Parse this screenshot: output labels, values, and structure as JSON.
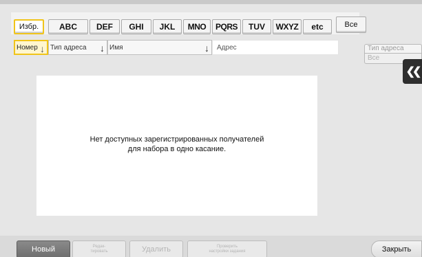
{
  "tabs": [
    {
      "id": "favorites",
      "label": "Избр.",
      "selected": true
    },
    {
      "id": "abc",
      "label": "ABC",
      "selected": false
    },
    {
      "id": "def",
      "label": "DEF",
      "selected": false
    },
    {
      "id": "ghi",
      "label": "GHI",
      "selected": false
    },
    {
      "id": "jkl",
      "label": "JKL",
      "selected": false
    },
    {
      "id": "mno",
      "label": "MNO",
      "selected": false
    },
    {
      "id": "pqrs",
      "label": "PQRS",
      "selected": false
    },
    {
      "id": "tuv",
      "label": "TUV",
      "selected": false
    },
    {
      "id": "wxyz",
      "label": "WXYZ",
      "selected": false
    },
    {
      "id": "etc",
      "label": "etc",
      "selected": false
    },
    {
      "id": "all",
      "label": "Все",
      "selected": false
    }
  ],
  "sort": {
    "number": "Номер",
    "address_type": "Тип адреса",
    "name": "Имя",
    "address": "Адрес"
  },
  "filter": {
    "label": "Тип адреса",
    "value": "Все"
  },
  "content": {
    "message_line1": "Нет доступных зарегистрированных получателей",
    "message_line2": "для набора в одно касание."
  },
  "bottom": {
    "new": "Новый",
    "edit": "Редак-\nтировать",
    "delete": "Удалить",
    "check_job": "Проверить\nнастройки задания",
    "close": "Закрыть"
  },
  "colors": {
    "selected_border": "#f0c419",
    "panel_dark": "#2e2e2e"
  }
}
